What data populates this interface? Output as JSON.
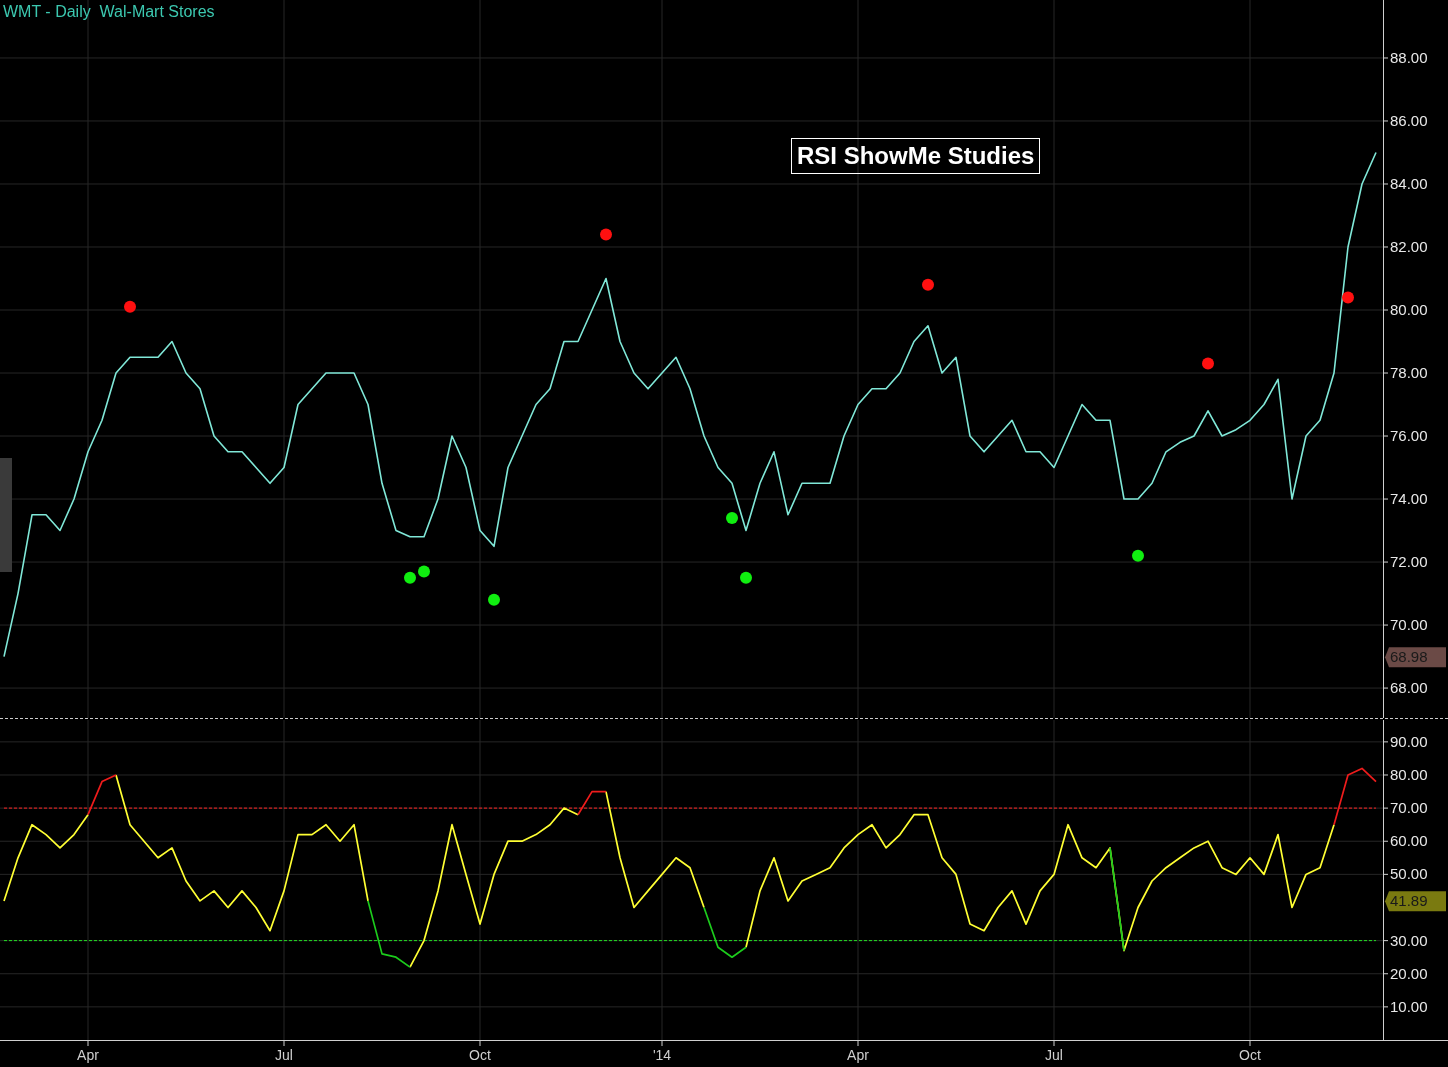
{
  "title": "WMT - Daily  Wal-Mart Stores",
  "study_label": "RSI ShowMe Studies",
  "price_panel": {
    "last_marker": "68.98",
    "chart_data": {
      "type": "line",
      "grid": true,
      "ylim": [
        67.05,
        89.84
      ],
      "yticks": [
        {
          "value": 68,
          "label": "68.00"
        },
        {
          "value": 70,
          "label": "70.00"
        },
        {
          "value": 72,
          "label": "72.00"
        },
        {
          "value": 74,
          "label": "74.00"
        },
        {
          "value": 76,
          "label": "76.00"
        },
        {
          "value": 78,
          "label": "78.00"
        },
        {
          "value": 80,
          "label": "80.00"
        },
        {
          "value": 82,
          "label": "82.00"
        },
        {
          "value": 84,
          "label": "84.00"
        },
        {
          "value": 86,
          "label": "86.00"
        },
        {
          "value": 88,
          "label": "88.00"
        }
      ],
      "series": [
        {
          "color": "#80e8d8",
          "values": [
            69,
            71,
            73.5,
            73.5,
            73,
            74,
            75.5,
            76.5,
            78,
            78.5,
            78.5,
            78.5,
            79,
            78,
            77.5,
            76,
            75.5,
            75.5,
            75,
            74.5,
            75,
            77,
            77.5,
            78,
            78,
            78,
            77,
            74.5,
            73,
            72.8,
            72.8,
            74,
            76,
            75,
            73,
            72.5,
            75,
            76,
            77,
            77.5,
            79,
            79,
            80,
            81,
            79,
            78,
            77.5,
            78,
            78.5,
            77.5,
            76,
            75,
            74.5,
            73,
            74.5,
            75.5,
            73.5,
            74.5,
            74.5,
            74.5,
            76,
            77,
            77.5,
            77.5,
            78,
            79,
            79.5,
            78,
            78.5,
            76,
            75.5,
            76,
            76.5,
            75.5,
            75.5,
            75,
            76,
            77,
            76.5,
            76.5,
            74,
            74,
            74.5,
            75.5,
            75.8,
            76,
            76.8,
            76,
            76.2,
            76.5,
            77,
            77.8,
            74,
            76,
            76.5,
            78,
            82,
            84,
            85
          ]
        },
        {
          "type": "scatter",
          "color": "#ff1010",
          "values": [
            null,
            null,
            null,
            null,
            null,
            null,
            null,
            null,
            null,
            80.1,
            null,
            null,
            null,
            null,
            null,
            null,
            null,
            null,
            null,
            null,
            null,
            null,
            null,
            null,
            null,
            null,
            null,
            null,
            null,
            null,
            null,
            null,
            null,
            null,
            null,
            null,
            null,
            null,
            null,
            null,
            null,
            null,
            null,
            82.4,
            null,
            null,
            null,
            null,
            null,
            null,
            null,
            null,
            null,
            null,
            null,
            null,
            null,
            null,
            null,
            null,
            null,
            null,
            null,
            null,
            null,
            null,
            80.8,
            null,
            null,
            null,
            null,
            null,
            null,
            null,
            null,
            null,
            null,
            null,
            null,
            null,
            null,
            null,
            null,
            null,
            null,
            null,
            78.3,
            null,
            null,
            null,
            null,
            null,
            null,
            null,
            null,
            null,
            80.4,
            null,
            null
          ]
        },
        {
          "type": "scatter",
          "color": "#10ee10",
          "values": [
            null,
            null,
            null,
            null,
            null,
            null,
            null,
            null,
            null,
            null,
            null,
            null,
            null,
            null,
            null,
            null,
            null,
            null,
            null,
            null,
            null,
            null,
            null,
            null,
            null,
            null,
            null,
            null,
            null,
            71.5,
            71.7,
            null,
            null,
            null,
            null,
            70.8,
            null,
            null,
            null,
            null,
            null,
            null,
            null,
            null,
            null,
            null,
            null,
            null,
            null,
            null,
            null,
            null,
            73.4,
            71.5,
            null,
            null,
            null,
            null,
            null,
            null,
            null,
            null,
            null,
            null,
            null,
            null,
            null,
            null,
            null,
            null,
            null,
            null,
            null,
            null,
            null,
            null,
            null,
            null,
            null,
            null,
            null,
            72.2,
            null,
            null,
            null,
            null,
            null,
            null,
            null,
            null,
            null,
            null,
            null,
            null,
            null,
            null,
            null,
            null,
            null
          ]
        }
      ]
    }
  },
  "rsi_panel": {
    "last_marker": "41.89",
    "chart_data": {
      "type": "line",
      "grid": true,
      "ylim": [
        0,
        96.6
      ],
      "categories": [
        null,
        null,
        null,
        null,
        null,
        null,
        "Apr",
        null,
        null,
        null,
        null,
        null,
        null,
        null,
        null,
        null,
        null,
        null,
        null,
        null,
        "Jul",
        null,
        null,
        null,
        null,
        null,
        null,
        null,
        null,
        null,
        null,
        null,
        null,
        null,
        "Oct",
        null,
        null,
        null,
        null,
        null,
        null,
        null,
        null,
        null,
        null,
        null,
        null,
        "'14",
        null,
        null,
        null,
        null,
        null,
        null,
        null,
        null,
        null,
        null,
        null,
        null,
        null,
        "Apr",
        null,
        null,
        null,
        null,
        null,
        null,
        null,
        null,
        null,
        null,
        null,
        null,
        null,
        "Jul",
        null,
        null,
        null,
        null,
        null,
        null,
        null,
        null,
        null,
        null,
        null,
        null,
        null,
        "Oct",
        null,
        null,
        null,
        null,
        null,
        null,
        null,
        null,
        null
      ],
      "yticks": [
        {
          "value": 10,
          "label": "10.00"
        },
        {
          "value": 20,
          "label": "20.00"
        },
        {
          "value": 30,
          "label": "30.00"
        },
        {
          "value": 50,
          "label": "50.00"
        },
        {
          "value": 60,
          "label": "60.00"
        },
        {
          "value": 70,
          "label": "70.00"
        },
        {
          "value": 80,
          "label": "80.00"
        },
        {
          "value": 90,
          "label": "90.00"
        }
      ],
      "series": [
        {
          "color": "#ff2020",
          "line_style": "dashed",
          "values": [
            70,
            70,
            70,
            70,
            70,
            70,
            70,
            70,
            70,
            70,
            70,
            70,
            70,
            70,
            70,
            70,
            70,
            70,
            70,
            70,
            70,
            70,
            70,
            70,
            70,
            70,
            70,
            70,
            70,
            70,
            70,
            70,
            70,
            70,
            70,
            70,
            70,
            70,
            70,
            70,
            70,
            70,
            70,
            70,
            70,
            70,
            70,
            70,
            70,
            70,
            70,
            70,
            70,
            70,
            70,
            70,
            70,
            70,
            70,
            70,
            70,
            70,
            70,
            70,
            70,
            70,
            70,
            70,
            70,
            70,
            70,
            70,
            70,
            70,
            70,
            70,
            70,
            70,
            70,
            70,
            70,
            70,
            70,
            70,
            70,
            70,
            70,
            70,
            70,
            70,
            70,
            70,
            70,
            70,
            70,
            70,
            70,
            70,
            70
          ]
        },
        {
          "color": "#22dd22",
          "line_style": "dashed",
          "values": [
            30,
            30,
            30,
            30,
            30,
            30,
            30,
            30,
            30,
            30,
            30,
            30,
            30,
            30,
            30,
            30,
            30,
            30,
            30,
            30,
            30,
            30,
            30,
            30,
            30,
            30,
            30,
            30,
            30,
            30,
            30,
            30,
            30,
            30,
            30,
            30,
            30,
            30,
            30,
            30,
            30,
            30,
            30,
            30,
            30,
            30,
            30,
            30,
            30,
            30,
            30,
            30,
            30,
            30,
            30,
            30,
            30,
            30,
            30,
            30,
            30,
            30,
            30,
            30,
            30,
            30,
            30,
            30,
            30,
            30,
            30,
            30,
            30,
            30,
            30,
            30,
            30,
            30,
            30,
            30,
            30,
            30,
            30,
            30,
            30,
            30,
            30,
            30,
            30,
            30,
            30,
            30,
            30,
            30,
            30,
            30,
            30,
            30,
            30
          ]
        },
        {
          "color": "#ffff33",
          "values": [
            42,
            55,
            65,
            62,
            58,
            62,
            68,
            null,
            80,
            65,
            60,
            55,
            58,
            48,
            42,
            45,
            40,
            45,
            40,
            33,
            45,
            62,
            62,
            65,
            60,
            65,
            42,
            null,
            null,
            22,
            30,
            45,
            65,
            50,
            35,
            50,
            60,
            60,
            62,
            65,
            70,
            68,
            null,
            75,
            55,
            40,
            45,
            50,
            55,
            52,
            40,
            null,
            null,
            28,
            45,
            55,
            42,
            48,
            50,
            52,
            58,
            62,
            65,
            58,
            62,
            68,
            68,
            55,
            50,
            35,
            33,
            40,
            45,
            35,
            45,
            50,
            65,
            55,
            52,
            58,
            27,
            40,
            48,
            52,
            55,
            58,
            60,
            52,
            50,
            55,
            50,
            62,
            40,
            50,
            52,
            65,
            null,
            null,
            null
          ]
        },
        {
          "color": "#ee1c1c",
          "values": [
            null,
            null,
            null,
            null,
            null,
            null,
            68,
            78,
            80,
            null,
            null,
            null,
            null,
            null,
            null,
            null,
            null,
            null,
            null,
            null,
            null,
            null,
            null,
            null,
            null,
            null,
            null,
            null,
            null,
            null,
            null,
            null,
            null,
            null,
            null,
            null,
            null,
            null,
            null,
            null,
            null,
            68,
            75,
            75,
            null,
            null,
            null,
            null,
            null,
            null,
            null,
            null,
            null,
            null,
            null,
            null,
            null,
            null,
            null,
            null,
            null,
            null,
            null,
            null,
            null,
            null,
            null,
            null,
            null,
            null,
            null,
            null,
            null,
            null,
            null,
            null,
            null,
            null,
            null,
            null,
            null,
            null,
            null,
            null,
            null,
            null,
            null,
            null,
            null,
            null,
            null,
            null,
            null,
            null,
            null,
            65,
            80,
            82,
            78
          ]
        },
        {
          "color": "#1ccc1c",
          "values": [
            null,
            null,
            null,
            null,
            null,
            null,
            null,
            null,
            null,
            null,
            null,
            null,
            null,
            null,
            null,
            null,
            null,
            null,
            null,
            null,
            null,
            null,
            null,
            null,
            null,
            null,
            42,
            26,
            25,
            22,
            null,
            null,
            null,
            null,
            null,
            null,
            null,
            null,
            null,
            null,
            null,
            null,
            null,
            null,
            null,
            null,
            null,
            null,
            null,
            null,
            40,
            28,
            25,
            28,
            null,
            null,
            null,
            null,
            null,
            null,
            null,
            null,
            null,
            null,
            null,
            null,
            null,
            null,
            null,
            null,
            null,
            null,
            null,
            null,
            null,
            null,
            null,
            null,
            null,
            58,
            27,
            null,
            null,
            null,
            null,
            null,
            null,
            null,
            null,
            null,
            null,
            null,
            null,
            null,
            null,
            null,
            null,
            null,
            null
          ]
        }
      ]
    }
  }
}
